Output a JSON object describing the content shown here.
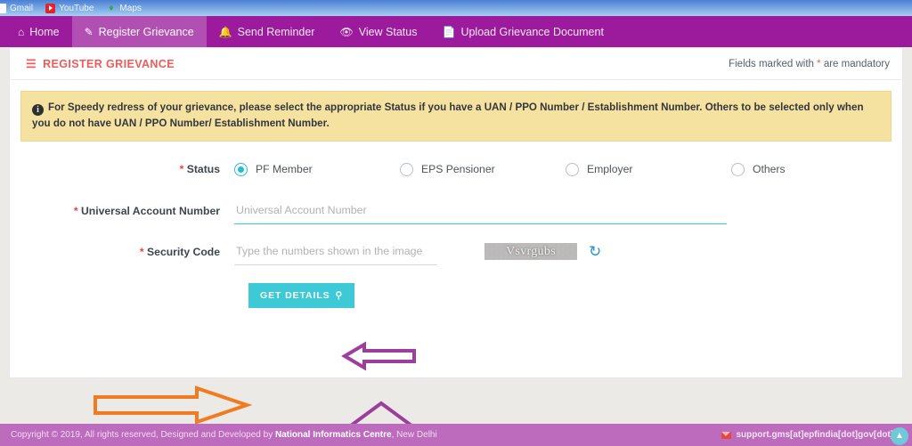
{
  "browser": {
    "bookmarks": [
      {
        "label": "Gmail",
        "icon": "gmail-icon"
      },
      {
        "label": "YouTube",
        "icon": "youtube-icon"
      },
      {
        "label": "Maps",
        "icon": "maps-icon"
      }
    ]
  },
  "navbar": {
    "brand_color": "#9c1a9c",
    "active_color": "#b24fb2",
    "items": [
      {
        "label": "Home",
        "icon": "home-icon",
        "glyph": "⌂",
        "active": false
      },
      {
        "label": "Register Grievance",
        "icon": "edit-document-icon",
        "glyph": "✎",
        "active": true
      },
      {
        "label": "Send Reminder",
        "icon": "bell-icon",
        "glyph": "⌇",
        "active": false
      },
      {
        "label": "View Status",
        "icon": "eye-icon",
        "glyph": "◉",
        "active": false
      },
      {
        "label": "Upload Grievance Document",
        "icon": "upload-file-icon",
        "glyph": "❐",
        "active": false
      }
    ]
  },
  "card": {
    "title": "REGISTER GRIEVANCE",
    "title_icon": "stack-layers-icon",
    "title_color": "#ef5b5b",
    "mandatory_note_prefix": "Fields marked with ",
    "mandatory_star": "*",
    "mandatory_note_suffix": " are mandatory"
  },
  "alert": {
    "icon": "info-icon",
    "icon_glyph": "i",
    "text": "For Speedy redress of your grievance, please select the appropriate Status if you have a UAN / PPO Number / Establishment Number. Others to be selected only when you do not have UAN / PPO Number/ Establishment Number.",
    "background": "#f6e2a0"
  },
  "form": {
    "status": {
      "label_star": "*",
      "label": " Status",
      "options": [
        {
          "label": "PF Member",
          "selected": true
        },
        {
          "label": "EPS Pensioner",
          "selected": false
        },
        {
          "label": "Employer",
          "selected": false
        },
        {
          "label": "Others",
          "selected": false
        }
      ],
      "accent_color": "#25bcd6"
    },
    "uan": {
      "label_star": "*",
      "label": " Universal Account Number",
      "value": "",
      "placeholder": "Universal Account Number",
      "underline_color": "#3ec9d6"
    },
    "security_code": {
      "label_star": "*",
      "label": " Security Code",
      "value": "",
      "placeholder": "Type the numbers shown in the image",
      "captcha_text": "Vsvrgubs",
      "refresh_icon": "refresh-icon",
      "refresh_glyph": "↻"
    },
    "submit": {
      "label": "GET DETAILS",
      "icon": "search-icon",
      "icon_glyph": "⚲",
      "color": "#3ec9d6"
    }
  },
  "annotations": [
    {
      "name": "uan-field-arrow",
      "direction": "left",
      "color": "#9c3f9c"
    },
    {
      "name": "security-code-arrow",
      "direction": "up",
      "color": "#9c3f9c"
    },
    {
      "name": "get-details-arrow",
      "direction": "right",
      "color": "#f07b20"
    }
  ],
  "footer": {
    "copyright_pre": "Copyright © 2019, All rights reserved, Designed and Developed by ",
    "org": "National Informatics Centre",
    "copyright_post": ", New Delhi",
    "support_email": "support.gms[at]epfindia[dot]gov[dot]in",
    "support_icon": "mail-icon",
    "scroll_icon": "scroll-to-top-icon",
    "scroll_glyph": "▲",
    "background": "#bd6cbd"
  }
}
